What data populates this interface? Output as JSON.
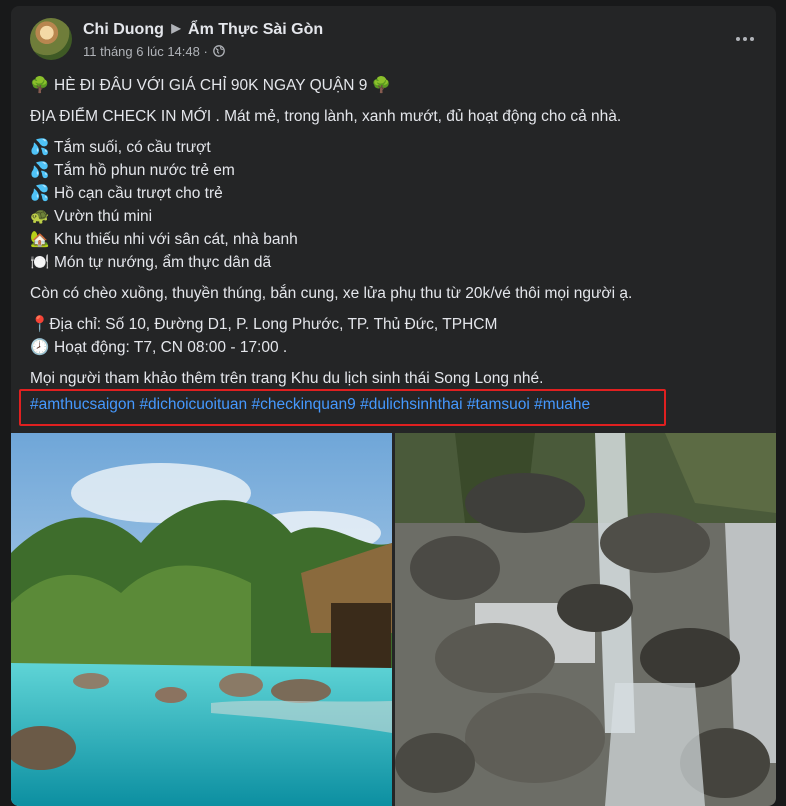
{
  "post": {
    "author": "Chi Duong",
    "group": "Ẩm Thực Sài Gòn",
    "timestamp": "11 tháng 6 lúc 14:48",
    "headline": "HÈ ĐI ĐÂU VỚI GIÁ CHỈ 90K NGAY QUẬN 9",
    "intro": "ĐỊA ĐIỂM CHECK IN MỚI . Mát mẻ, trong lành, xanh mướt, đủ hoạt động cho cả nhà.",
    "features": [
      {
        "icon": "💦",
        "text": "Tắm suối, có cầu trượt"
      },
      {
        "icon": "💦",
        "text": "Tắm hồ phun nước trẻ em"
      },
      {
        "icon": "💦",
        "text": "Hồ cạn cầu trượt cho trẻ"
      },
      {
        "icon": "🐢",
        "text": "Vườn thú mini"
      },
      {
        "icon": "🏡",
        "text": "Khu thiếu nhi với sân cát, nhà banh"
      },
      {
        "icon": "🍽️",
        "text": "Món tự nướng, ẩm thực dân dã"
      }
    ],
    "extras": "Còn có chèo xuồng, thuyền thúng, bắn cung, xe lửa phụ thu từ 20k/vé thôi mọi người ạ.",
    "address": "Địa chỉ: Số 10, Đường D1, P. Long Phước, TP. Thủ Đức, TPHCM",
    "address_icon": "📍",
    "hours": "Hoạt động: T7, CN 08:00 - 17:00 .",
    "hours_icon": "🕗",
    "headline_icon": "🌳",
    "closing": "Mọi người tham khảo thêm trên trang Khu du lịch sinh thái Song Long nhé.",
    "hashtags": [
      "#amthucsaigon",
      "#dichoicuoituan",
      "#checkinquan9",
      "#dulichsinhthai",
      "#tamsuoi",
      "#muahe"
    ]
  },
  "colors": {
    "background": "#18191a",
    "card": "#242526",
    "text": "#e4e6eb",
    "secondary_text": "#b0b3b8",
    "hashtag": "#4599ff",
    "highlight_border": "#e02020"
  }
}
